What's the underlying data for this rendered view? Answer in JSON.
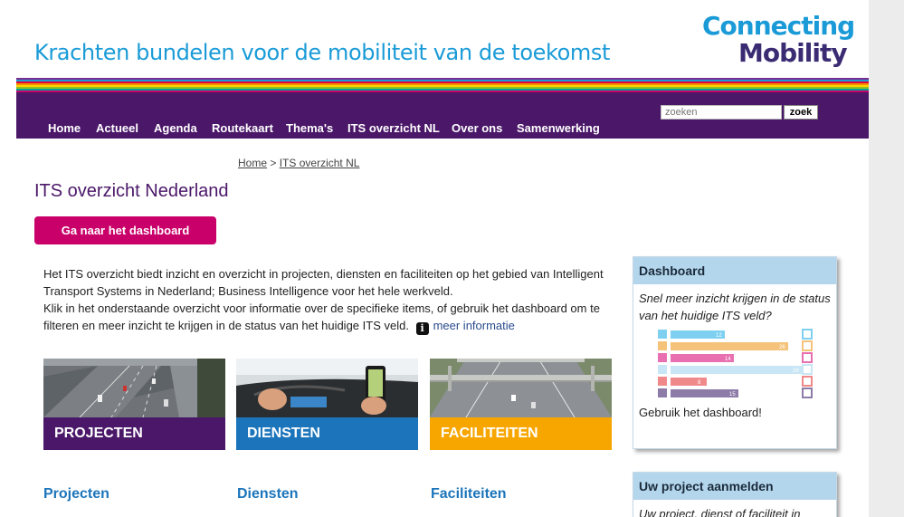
{
  "header": {
    "tagline": "Krachten bundelen voor de mobiliteit van de toekomst",
    "logo_line1": "Connecting",
    "logo_line2": "Mobility"
  },
  "stripe_colors": [
    "#7b2d8e",
    "#1a9bd7",
    "#e4003a",
    "#f39200",
    "#ffd200",
    "#95c11f",
    "#00a19a",
    "#c9006a",
    "#4b1869"
  ],
  "nav": {
    "items": [
      "Home",
      "Actueel",
      "Agenda",
      "Routekaart",
      "Thema's",
      "ITS overzicht NL",
      "Over ons",
      "Samenwerking"
    ],
    "search_placeholder": "zoeken",
    "search_button": "zoek"
  },
  "breadcrumb": {
    "home": "Home",
    "separator": ">",
    "current": "ITS overzicht NL"
  },
  "main": {
    "title": "ITS overzicht Nederland",
    "dashboard_button": "Ga naar het dashboard",
    "intro_p1": "Het ITS overzicht biedt inzicht en overzicht in projecten, diensten en faciliteiten op het gebied van Intelligent Transport Systems in Nederland; Business Intelligence voor het hele werkveld.",
    "intro_p2": "Klik in het onderstaande overzicht voor informatie over de specifieke items, of gebruik het dashboard om te filteren en meer inzicht te krijgen in de status van het huidige ITS veld.",
    "info_icon": "i",
    "meer_info": "meer informatie",
    "tiles": [
      {
        "label": "PROJECTEN",
        "color": "#4b1869"
      },
      {
        "label": "DIENSTEN",
        "color": "#1c75bb"
      },
      {
        "label": "FACILITEITEN",
        "color": "#f7a600"
      }
    ],
    "sections": [
      "Projecten",
      "Diensten",
      "Faciliteiten"
    ]
  },
  "sidebar": {
    "dashboard": {
      "title": "Dashboard",
      "text": "Snel meer inzicht krijgen in de status van het huidige ITS veld?",
      "link": "Gebruik het dashboard!",
      "mini_bars": [
        {
          "value": "12",
          "color": "#7fd0f0"
        },
        {
          "value": "26",
          "color": "#f5c27a"
        },
        {
          "value": "14",
          "color": "#e86fb0"
        },
        {
          "value": "29",
          "color": "#c8e6f5"
        },
        {
          "value": "8",
          "color": "#f08a8a"
        },
        {
          "value": "15",
          "color": "#8d7ca8"
        }
      ]
    },
    "aanmelden": {
      "title": "Uw project aanmelden",
      "text": "Uw project, dienst of faciliteit in"
    }
  }
}
